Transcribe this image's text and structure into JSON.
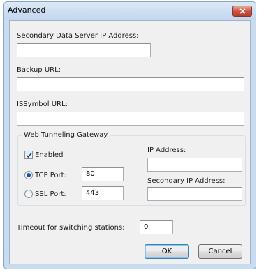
{
  "window": {
    "title": "Advanced"
  },
  "secondary_server": {
    "label": "Secondary Data Server IP Address:",
    "value": ""
  },
  "backup_url": {
    "label": "Backup URL:",
    "value": ""
  },
  "issymbol_url": {
    "label": "ISSymbol URL:",
    "value": ""
  },
  "gateway": {
    "title": "Web Tunneling Gateway",
    "enabled_label": "Enabled",
    "enabled": true,
    "tcp_label": "TCP Port:",
    "tcp_value": "80",
    "ssl_label": "SSL Port:",
    "ssl_value": "443",
    "selected_protocol": "TCP",
    "ip_label": "IP Address:",
    "ip_value": "",
    "secondary_ip_label": "Secondary IP Address:",
    "secondary_ip_value": ""
  },
  "timeout": {
    "label": "Timeout for switching stations:",
    "value": "0"
  },
  "buttons": {
    "ok": "OK",
    "cancel": "Cancel"
  },
  "colors": {
    "title_bar": "#c9dbef",
    "close_button": "#c9503d",
    "client_bg": "#f0f0f0"
  }
}
